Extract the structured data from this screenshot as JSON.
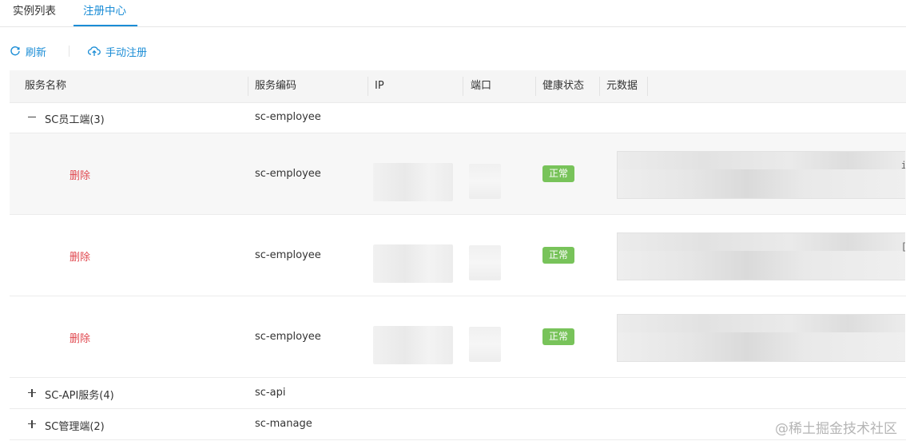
{
  "tabs": [
    {
      "label": "实例列表",
      "active": false
    },
    {
      "label": "注册中心",
      "active": true
    }
  ],
  "toolbar": {
    "refresh_label": "刷新",
    "register_label": "手动注册",
    "refresh_icon": "refresh-icon",
    "register_icon": "cloud-upload-icon"
  },
  "table": {
    "columns": [
      "服务名称",
      "服务编码",
      "IP",
      "端口",
      "健康状态",
      "元数据"
    ],
    "groups": [
      {
        "name": "SC员工端(3)",
        "code": "sc-employee",
        "expanded": true,
        "instances": [
          {
            "action": "删除",
            "code": "sc-employee",
            "status": "正常",
            "meta_glyph": "i"
          },
          {
            "action": "删除",
            "code": "sc-employee",
            "status": "正常",
            "meta_glyph": "["
          },
          {
            "action": "删除",
            "code": "sc-employee",
            "status": "正常",
            "meta_glyph": ""
          }
        ]
      },
      {
        "name": "SC-API服务(4)",
        "code": "sc-api",
        "expanded": false
      },
      {
        "name": "SC管理端(2)",
        "code": "sc-manage",
        "expanded": false
      }
    ]
  },
  "colors": {
    "accent": "#1b8dd6",
    "danger": "#e0484f",
    "success": "#78c35a",
    "header_bg": "#f5f5f5"
  },
  "watermark": "@稀土掘金技术社区"
}
